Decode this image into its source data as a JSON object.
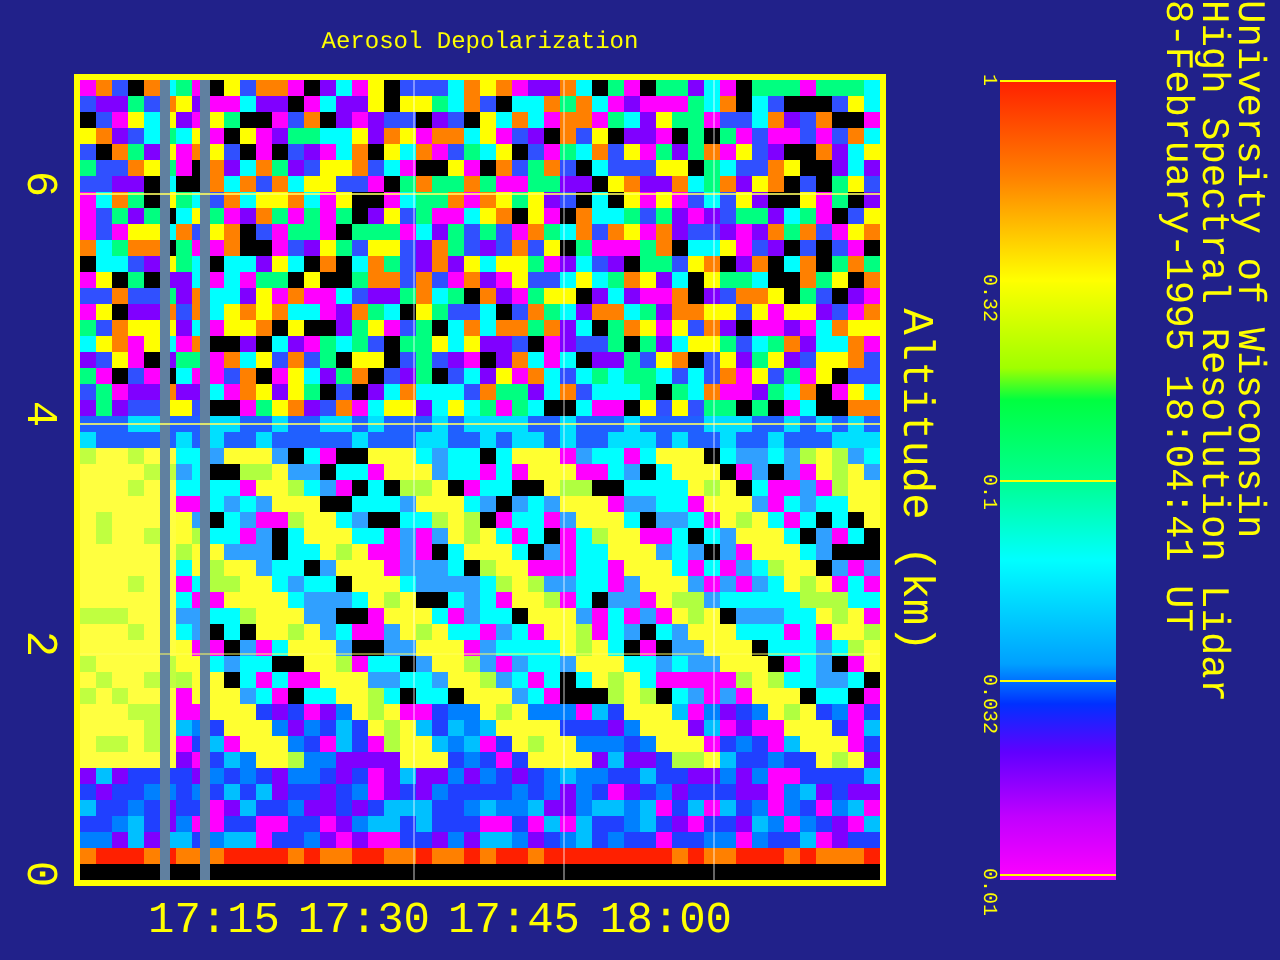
{
  "plot": {
    "title": "Aerosol Depolarization",
    "ylabel": "Altitude (km)",
    "yticks": [
      "0",
      "2",
      "4",
      "6"
    ],
    "xticks": [
      "17:15",
      "17:30",
      "17:45",
      "18:00"
    ]
  },
  "colorbar": {
    "ticks": [
      "1",
      "0.32",
      "0.1",
      "0.032",
      "0.01"
    ]
  },
  "caption": {
    "lines": [
      "University of Wisconsin",
      "High Spectral Resolution Lidar",
      "8-February-1995 18:04:41 UT"
    ]
  }
}
